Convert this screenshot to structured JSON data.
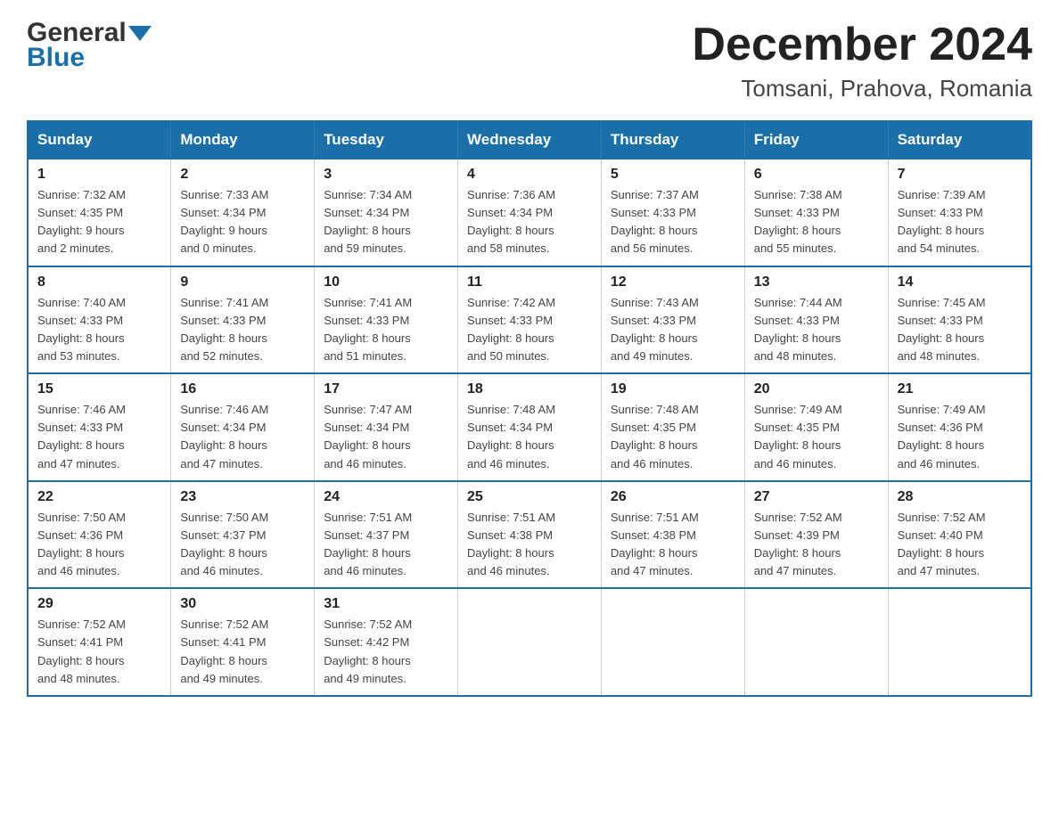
{
  "header": {
    "logo_general": "General",
    "logo_blue": "Blue",
    "month_title": "December 2024",
    "location": "Tomsani, Prahova, Romania"
  },
  "days_of_week": [
    "Sunday",
    "Monday",
    "Tuesday",
    "Wednesday",
    "Thursday",
    "Friday",
    "Saturday"
  ],
  "weeks": [
    [
      {
        "day": "1",
        "sunrise": "7:32 AM",
        "sunset": "4:35 PM",
        "daylight": "9 hours and 2 minutes."
      },
      {
        "day": "2",
        "sunrise": "7:33 AM",
        "sunset": "4:34 PM",
        "daylight": "9 hours and 0 minutes."
      },
      {
        "day": "3",
        "sunrise": "7:34 AM",
        "sunset": "4:34 PM",
        "daylight": "8 hours and 59 minutes."
      },
      {
        "day": "4",
        "sunrise": "7:36 AM",
        "sunset": "4:34 PM",
        "daylight": "8 hours and 58 minutes."
      },
      {
        "day": "5",
        "sunrise": "7:37 AM",
        "sunset": "4:33 PM",
        "daylight": "8 hours and 56 minutes."
      },
      {
        "day": "6",
        "sunrise": "7:38 AM",
        "sunset": "4:33 PM",
        "daylight": "8 hours and 55 minutes."
      },
      {
        "day": "7",
        "sunrise": "7:39 AM",
        "sunset": "4:33 PM",
        "daylight": "8 hours and 54 minutes."
      }
    ],
    [
      {
        "day": "8",
        "sunrise": "7:40 AM",
        "sunset": "4:33 PM",
        "daylight": "8 hours and 53 minutes."
      },
      {
        "day": "9",
        "sunrise": "7:41 AM",
        "sunset": "4:33 PM",
        "daylight": "8 hours and 52 minutes."
      },
      {
        "day": "10",
        "sunrise": "7:41 AM",
        "sunset": "4:33 PM",
        "daylight": "8 hours and 51 minutes."
      },
      {
        "day": "11",
        "sunrise": "7:42 AM",
        "sunset": "4:33 PM",
        "daylight": "8 hours and 50 minutes."
      },
      {
        "day": "12",
        "sunrise": "7:43 AM",
        "sunset": "4:33 PM",
        "daylight": "8 hours and 49 minutes."
      },
      {
        "day": "13",
        "sunrise": "7:44 AM",
        "sunset": "4:33 PM",
        "daylight": "8 hours and 48 minutes."
      },
      {
        "day": "14",
        "sunrise": "7:45 AM",
        "sunset": "4:33 PM",
        "daylight": "8 hours and 48 minutes."
      }
    ],
    [
      {
        "day": "15",
        "sunrise": "7:46 AM",
        "sunset": "4:33 PM",
        "daylight": "8 hours and 47 minutes."
      },
      {
        "day": "16",
        "sunrise": "7:46 AM",
        "sunset": "4:34 PM",
        "daylight": "8 hours and 47 minutes."
      },
      {
        "day": "17",
        "sunrise": "7:47 AM",
        "sunset": "4:34 PM",
        "daylight": "8 hours and 46 minutes."
      },
      {
        "day": "18",
        "sunrise": "7:48 AM",
        "sunset": "4:34 PM",
        "daylight": "8 hours and 46 minutes."
      },
      {
        "day": "19",
        "sunrise": "7:48 AM",
        "sunset": "4:35 PM",
        "daylight": "8 hours and 46 minutes."
      },
      {
        "day": "20",
        "sunrise": "7:49 AM",
        "sunset": "4:35 PM",
        "daylight": "8 hours and 46 minutes."
      },
      {
        "day": "21",
        "sunrise": "7:49 AM",
        "sunset": "4:36 PM",
        "daylight": "8 hours and 46 minutes."
      }
    ],
    [
      {
        "day": "22",
        "sunrise": "7:50 AM",
        "sunset": "4:36 PM",
        "daylight": "8 hours and 46 minutes."
      },
      {
        "day": "23",
        "sunrise": "7:50 AM",
        "sunset": "4:37 PM",
        "daylight": "8 hours and 46 minutes."
      },
      {
        "day": "24",
        "sunrise": "7:51 AM",
        "sunset": "4:37 PM",
        "daylight": "8 hours and 46 minutes."
      },
      {
        "day": "25",
        "sunrise": "7:51 AM",
        "sunset": "4:38 PM",
        "daylight": "8 hours and 46 minutes."
      },
      {
        "day": "26",
        "sunrise": "7:51 AM",
        "sunset": "4:38 PM",
        "daylight": "8 hours and 47 minutes."
      },
      {
        "day": "27",
        "sunrise": "7:52 AM",
        "sunset": "4:39 PM",
        "daylight": "8 hours and 47 minutes."
      },
      {
        "day": "28",
        "sunrise": "7:52 AM",
        "sunset": "4:40 PM",
        "daylight": "8 hours and 47 minutes."
      }
    ],
    [
      {
        "day": "29",
        "sunrise": "7:52 AM",
        "sunset": "4:41 PM",
        "daylight": "8 hours and 48 minutes."
      },
      {
        "day": "30",
        "sunrise": "7:52 AM",
        "sunset": "4:41 PM",
        "daylight": "8 hours and 49 minutes."
      },
      {
        "day": "31",
        "sunrise": "7:52 AM",
        "sunset": "4:42 PM",
        "daylight": "8 hours and 49 minutes."
      },
      null,
      null,
      null,
      null
    ]
  ],
  "labels": {
    "sunrise": "Sunrise:",
    "sunset": "Sunset:",
    "daylight": "Daylight:"
  }
}
